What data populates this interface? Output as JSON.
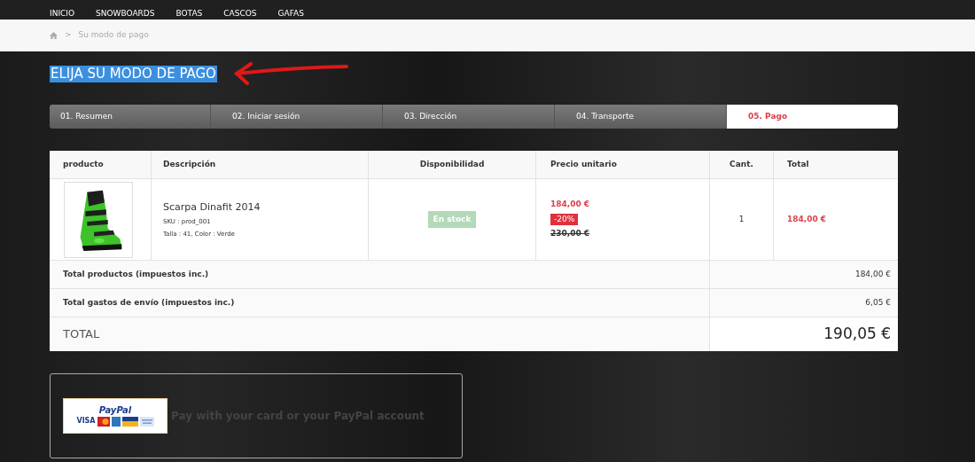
{
  "nav": [
    "INICIO",
    "SNOWBOARDS",
    "BOTAS",
    "CASCOS",
    "GAFAS"
  ],
  "breadcrumb": {
    "separator": ">",
    "current": "Su modo de pago"
  },
  "title": "ELIJA SU MODO DE PAGO",
  "steps": [
    {
      "label": "01. Resumen",
      "selected": false
    },
    {
      "label": "02. Iniciar sesión",
      "selected": false
    },
    {
      "label": "03. Dirección",
      "selected": false
    },
    {
      "label": "04. Transporte",
      "selected": false
    },
    {
      "label": "05. Pago",
      "selected": true
    }
  ],
  "table": {
    "columns": [
      "producto",
      "Descripción",
      "Disponibilidad",
      "Precio unitario",
      "Cant.",
      "Total"
    ],
    "rows": [
      {
        "name": "Scarpa Dinafit 2014",
        "sku": "SKU : prod_001",
        "attributes": "Talla : 41, Color : Verde",
        "availability": "En stock",
        "price": "184,00 €",
        "discount": "-20%",
        "old_price": "230,00 €",
        "quantity": "1",
        "total": "184,00 €"
      }
    ],
    "totals": [
      {
        "label": "Total productos (impuestos inc.)",
        "value": "184,00 €"
      },
      {
        "label": "Total gastos de envío (impuestos inc.)",
        "value": "6,05 €"
      }
    ],
    "grand_total": {
      "label": "TOTAL",
      "value": "190,05 €"
    }
  },
  "payment": {
    "logo": {
      "brand": "PayPal",
      "card": "VISA"
    },
    "text": "Pay with your card or your PayPal account"
  }
}
